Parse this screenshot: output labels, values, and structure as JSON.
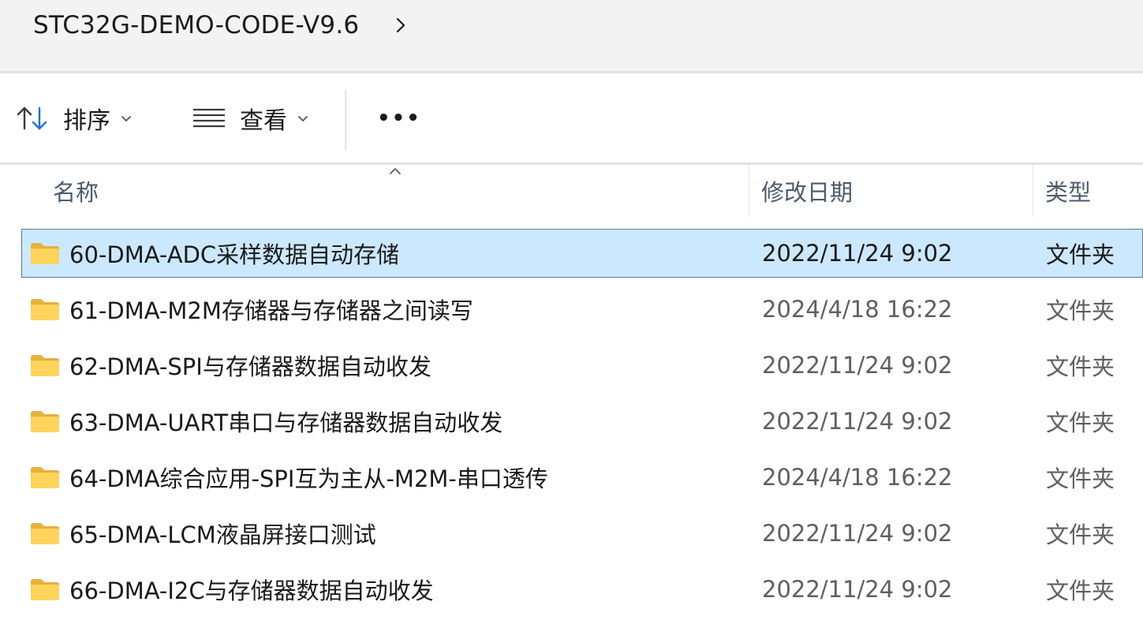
{
  "breadcrumb": {
    "current": "STC32G-DEMO-CODE-V9.6"
  },
  "toolbar": {
    "sort_label": "排序",
    "view_label": "查看",
    "more_label": "•••"
  },
  "columns": {
    "name": "名称",
    "date": "修改日期",
    "type": "类型"
  },
  "rows": [
    {
      "name": "60-DMA-ADC采样数据自动存储",
      "date": "2022/11/24 9:02",
      "type": "文件夹",
      "selected": true
    },
    {
      "name": "61-DMA-M2M存储器与存储器之间读写",
      "date": "2024/4/18 16:22",
      "type": "文件夹",
      "selected": false
    },
    {
      "name": "62-DMA-SPI与存储器数据自动收发",
      "date": "2022/11/24 9:02",
      "type": "文件夹",
      "selected": false
    },
    {
      "name": "63-DMA-UART串口与存储器数据自动收发",
      "date": "2022/11/24 9:02",
      "type": "文件夹",
      "selected": false
    },
    {
      "name": "64-DMA综合应用-SPI互为主从-M2M-串口透传",
      "date": "2024/4/18 16:22",
      "type": "文件夹",
      "selected": false
    },
    {
      "name": "65-DMA-LCM液晶屏接口测试",
      "date": "2022/11/24 9:02",
      "type": "文件夹",
      "selected": false
    },
    {
      "name": "66-DMA-I2C与存储器数据自动收发",
      "date": "2022/11/24 9:02",
      "type": "文件夹",
      "selected": false
    }
  ],
  "colors": {
    "accent": "#1f6fd6",
    "selection": "#cce8ff",
    "folder": "#ffd35c"
  }
}
